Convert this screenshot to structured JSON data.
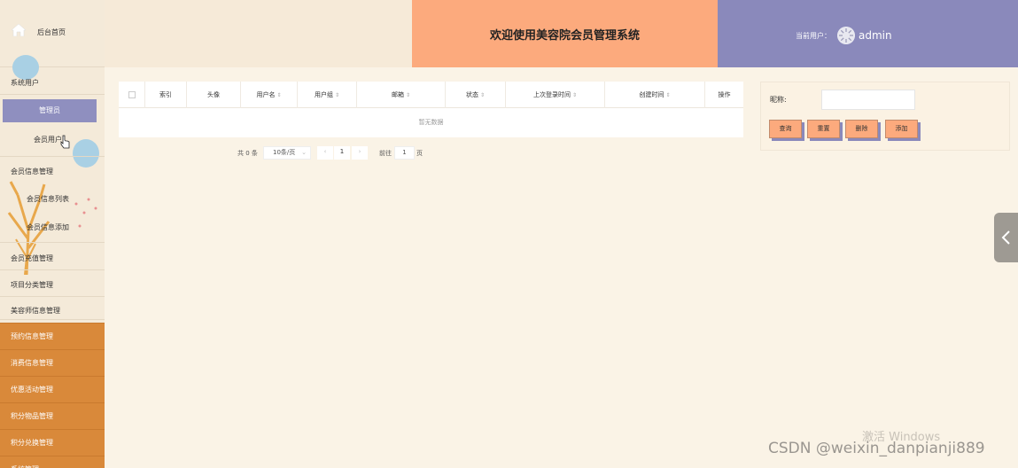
{
  "sidebar": {
    "home": "后台首页",
    "groups": [
      {
        "label": "系统用户"
      },
      {
        "label": "会员信息管理"
      },
      {
        "label": "会员充值管理"
      },
      {
        "label": "项目分类管理"
      },
      {
        "label": "美容师信息管理"
      }
    ],
    "sub_items": {
      "admin": "管理员",
      "member_user": "会员用户",
      "member_list": "会员信息列表",
      "member_add": "会员信息添加"
    },
    "orange_items": [
      "预约信息管理",
      "消费信息管理",
      "优惠活动管理",
      "积分物品管理",
      "积分兑换管理",
      "系统管理"
    ]
  },
  "header": {
    "title": "欢迎使用美容院会员管理系统",
    "user_label": "当前用户：",
    "username": "admin"
  },
  "table": {
    "columns": [
      "索引",
      "头像",
      "用户名",
      "用户组",
      "邮箱",
      "状态",
      "上次登录时间",
      "创建时间",
      "操作"
    ],
    "empty_text": "暂无数据"
  },
  "pagination": {
    "total": "共 0 条",
    "page_size": "10条/页",
    "current_page": "1",
    "goto_label": "前往",
    "goto_value": "1",
    "page_unit": "页"
  },
  "search": {
    "nickname_label": "昵称:",
    "nickname_value": "",
    "buttons": {
      "query": "查询",
      "reset": "重置",
      "delete": "删除",
      "add": "添加"
    }
  },
  "watermark": {
    "windows": "激活 Windows",
    "csdn": "CSDN @weixin_danpianji889"
  },
  "colors": {
    "header_title_bg": "#fcaa7d",
    "header_user_bg": "#8a89bb",
    "sidebar_active": "#8f8fbf",
    "sidebar_orange": "#d9893a"
  }
}
